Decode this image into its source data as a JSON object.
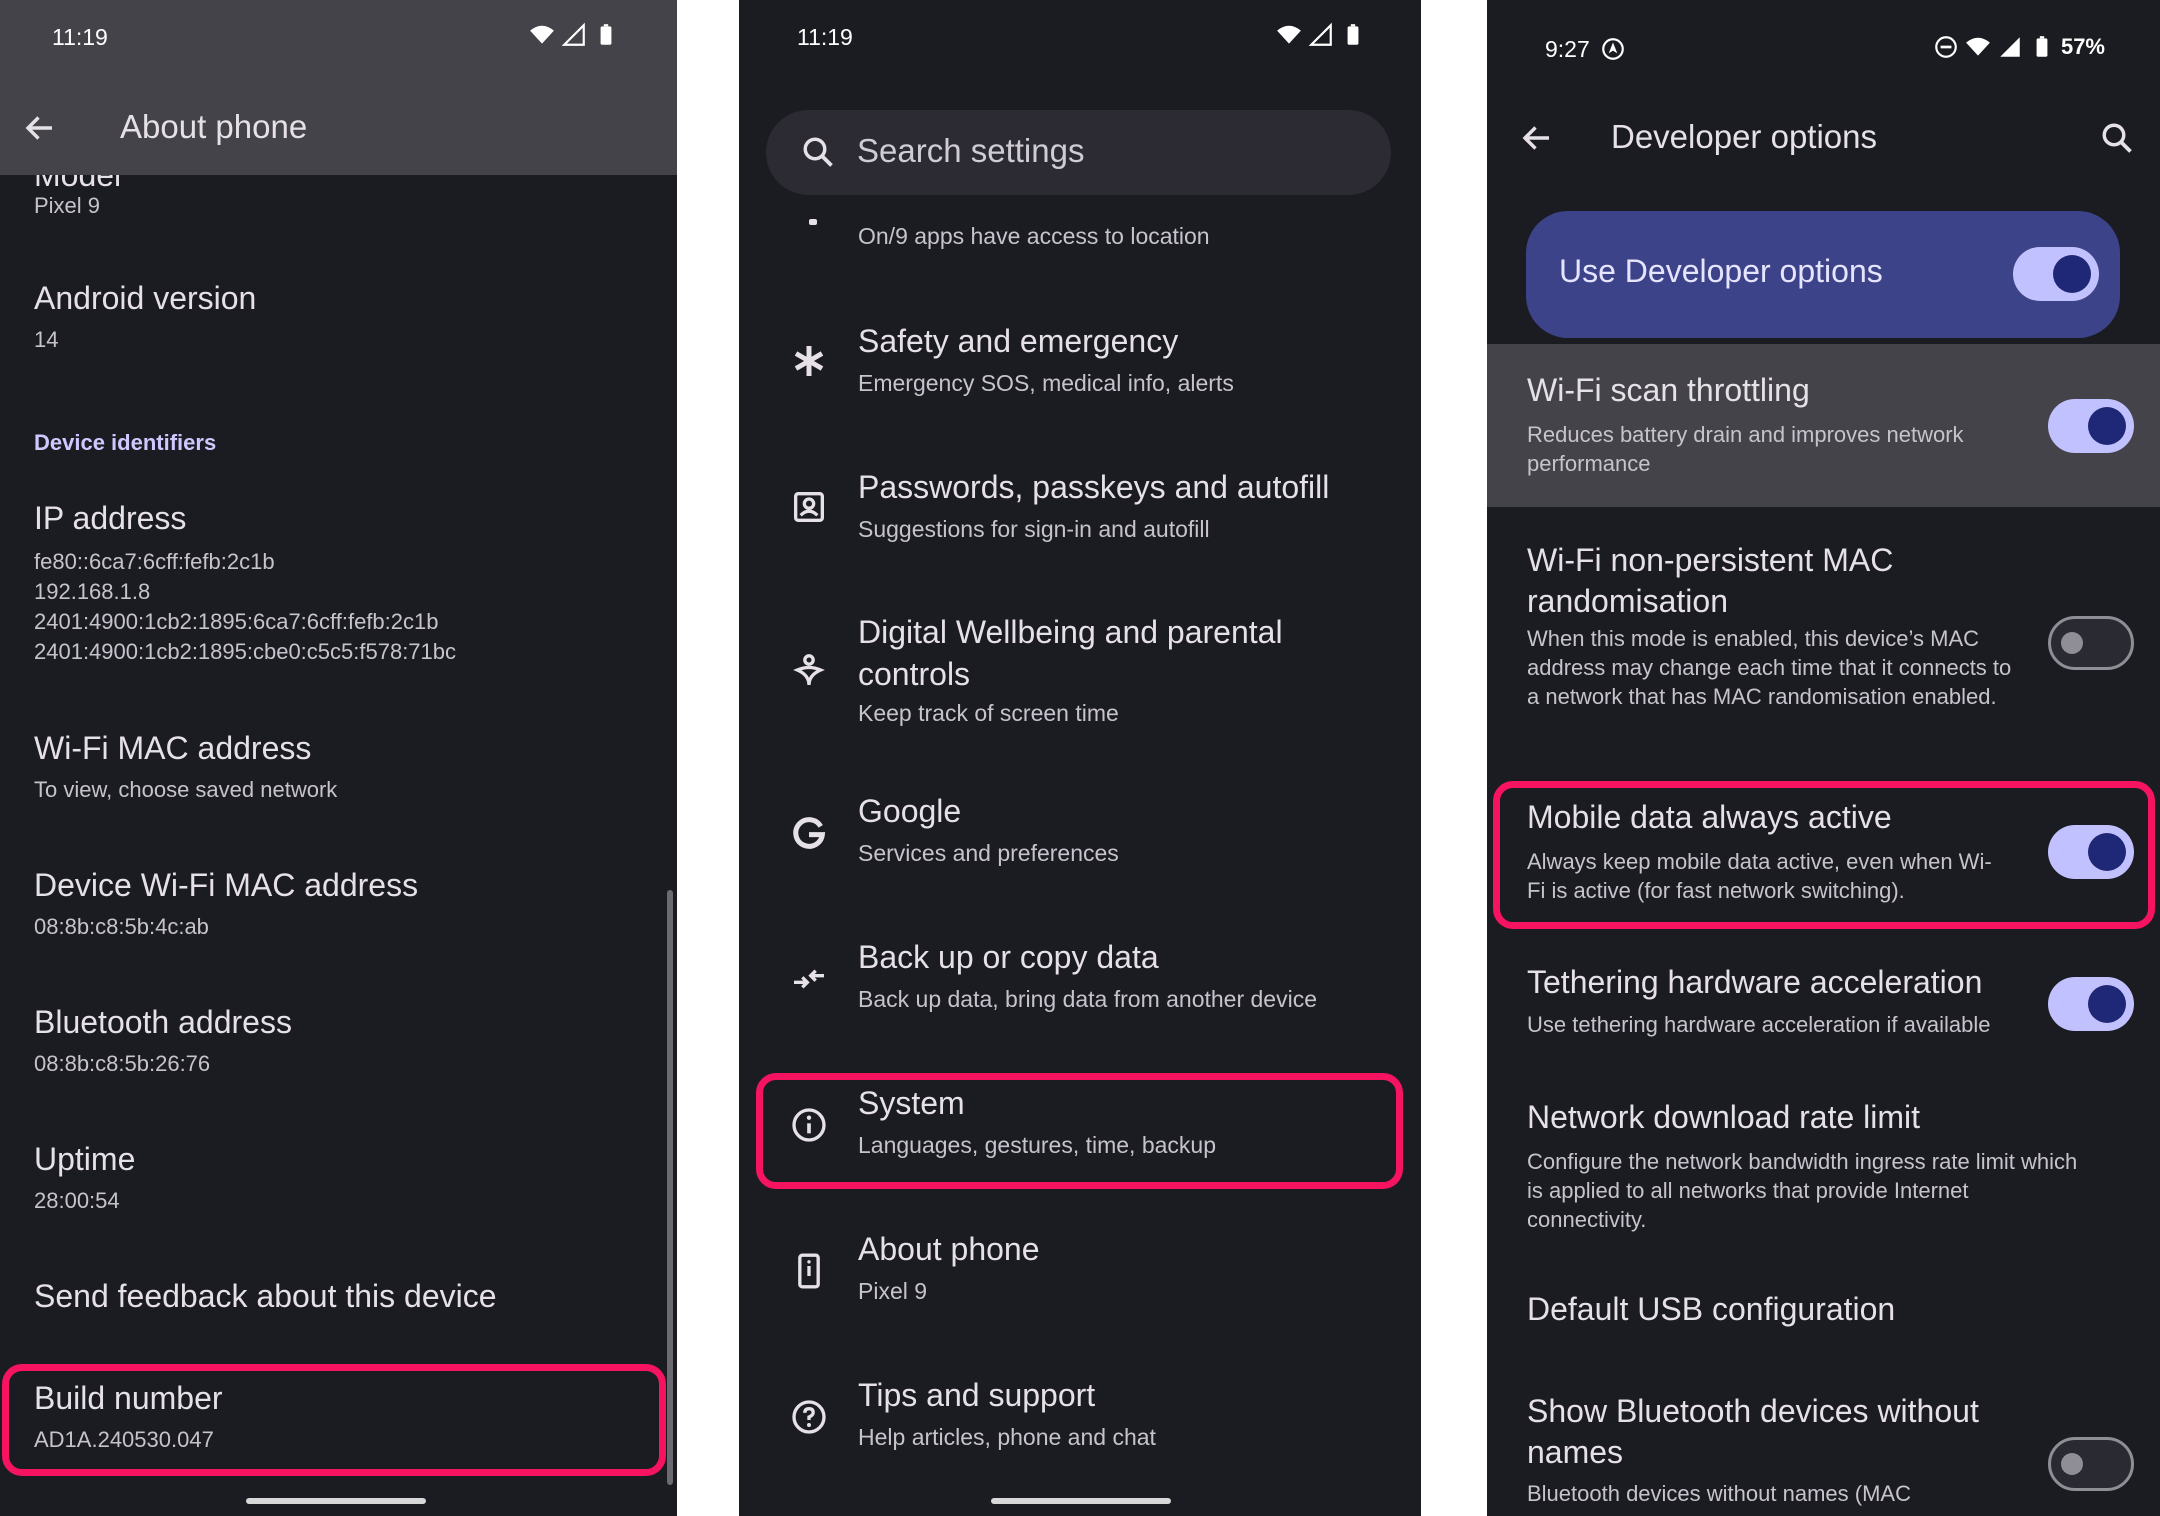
{
  "panel1": {
    "status_time": "11:19",
    "header_title": "About phone",
    "model_partial": "Model",
    "model_value": "Pixel 9",
    "android_version_label": "Android version",
    "android_version_value": "14",
    "section_device_identifiers": "Device identifiers",
    "ip_label": "IP address",
    "ip_values": [
      "fe80::6ca7:6cff:fefb:2c1b",
      "192.168.1.8",
      "2401:4900:1cb2:1895:6ca7:6cff:fefb:2c1b",
      "2401:4900:1cb2:1895:cbe0:c5c5:f578:71bc"
    ],
    "wifi_mac_label": "Wi-Fi MAC address",
    "wifi_mac_value": "To view, choose saved network",
    "device_wifi_mac_label": "Device Wi-Fi MAC address",
    "device_wifi_mac_value": "08:8b:c8:5b:4c:ab",
    "bluetooth_label": "Bluetooth address",
    "bluetooth_value": "08:8b:c8:5b:26:76",
    "uptime_label": "Uptime",
    "uptime_value": "28:00:54",
    "feedback_label": "Send feedback about this device",
    "build_label": "Build number",
    "build_value": "AD1A.240530.047"
  },
  "panel2": {
    "status_time": "11:19",
    "search_placeholder": "Search settings",
    "location_sub": "On/9 apps have access to location",
    "items": [
      {
        "title": "Safety and emergency",
        "sub": "Emergency SOS, medical info, alerts",
        "icon": "asterisk-icon"
      },
      {
        "title": "Passwords, passkeys and autofill",
        "sub": "Suggestions for sign-in and autofill",
        "icon": "account-box-icon"
      },
      {
        "title": "Digital Wellbeing and parental controls",
        "sub": "Keep track of screen time",
        "icon": "wellbeing-icon"
      },
      {
        "title": "Google",
        "sub": "Services and preferences",
        "icon": "google-icon"
      },
      {
        "title": "Back up or copy data",
        "sub": "Back up data, bring data from another device",
        "icon": "transfer-icon"
      },
      {
        "title": "System",
        "sub": "Languages, gestures, time, backup",
        "icon": "info-icon"
      },
      {
        "title": "About phone",
        "sub": "Pixel 9",
        "icon": "phone-icon"
      },
      {
        "title": "Tips and support",
        "sub": "Help articles, phone and chat",
        "icon": "help-icon"
      }
    ]
  },
  "panel3": {
    "status_time": "9:27",
    "battery_text": "57%",
    "header_title": "Developer options",
    "main_toggle_label": "Use Developer options",
    "items": [
      {
        "title": "Wi-Fi scan throttling",
        "sub": "Reduces battery drain and improves network performance",
        "toggle": "on"
      },
      {
        "title": "Wi-Fi non-persistent MAC randomisation",
        "sub": "When this mode is enabled, this device’s MAC address may change each time that it connects to a network that has MAC randomisation enabled.",
        "toggle": "off"
      },
      {
        "title": "Mobile data always active",
        "sub": "Always keep mobile data active, even when Wi-Fi is active (for fast network switching).",
        "toggle": "on"
      },
      {
        "title": "Tethering hardware acceleration",
        "sub": "Use tethering hardware acceleration if available",
        "toggle": "on"
      },
      {
        "title": "Network download rate limit",
        "sub": "Configure the network bandwidth ingress rate limit which is applied to all networks that provide Internet connectivity.",
        "toggle": ""
      },
      {
        "title": "Default USB configuration",
        "sub": "",
        "toggle": ""
      },
      {
        "title": "Show Bluetooth devices without names",
        "sub": "Bluetooth devices without names (MAC",
        "toggle": "off"
      }
    ]
  },
  "colors": {
    "highlight": "#f6135f",
    "accent_toggle": "#c2c1ff",
    "dev_banner": "#3d4388"
  }
}
